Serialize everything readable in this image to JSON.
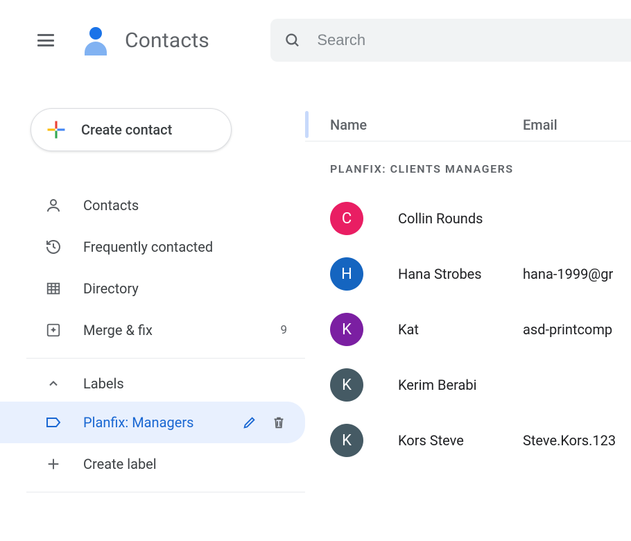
{
  "app": {
    "title": "Contacts"
  },
  "search": {
    "placeholder": "Search"
  },
  "sidebar": {
    "create_label": "Create contact",
    "items": [
      {
        "label": "Contacts"
      },
      {
        "label": "Frequently contacted"
      },
      {
        "label": "Directory"
      },
      {
        "label": "Merge & fix",
        "count": "9"
      }
    ],
    "labels_header": "Labels",
    "labels": [
      {
        "label": "Planfix: Managers",
        "selected": true
      }
    ],
    "create_label_label": "Create label"
  },
  "table": {
    "headers": {
      "name": "Name",
      "email": "Email"
    },
    "section_title": "PLANFIX: CLIENTS MANAGERS",
    "rows": [
      {
        "initial": "C",
        "color": "#e91e63",
        "name": "Collin Rounds",
        "email": ""
      },
      {
        "initial": "H",
        "color": "#1565c0",
        "name": "Hana Strobes",
        "email": "hana-1999@gr"
      },
      {
        "initial": "K",
        "color": "#7b1fa2",
        "name": "Kat",
        "email": "asd-printcomp"
      },
      {
        "initial": "K",
        "color": "#455a64",
        "name": "Kerim Berabi",
        "email": ""
      },
      {
        "initial": "K",
        "color": "#455a64",
        "name": "Kors Steve",
        "email": "Steve.Kors.123"
      }
    ]
  }
}
